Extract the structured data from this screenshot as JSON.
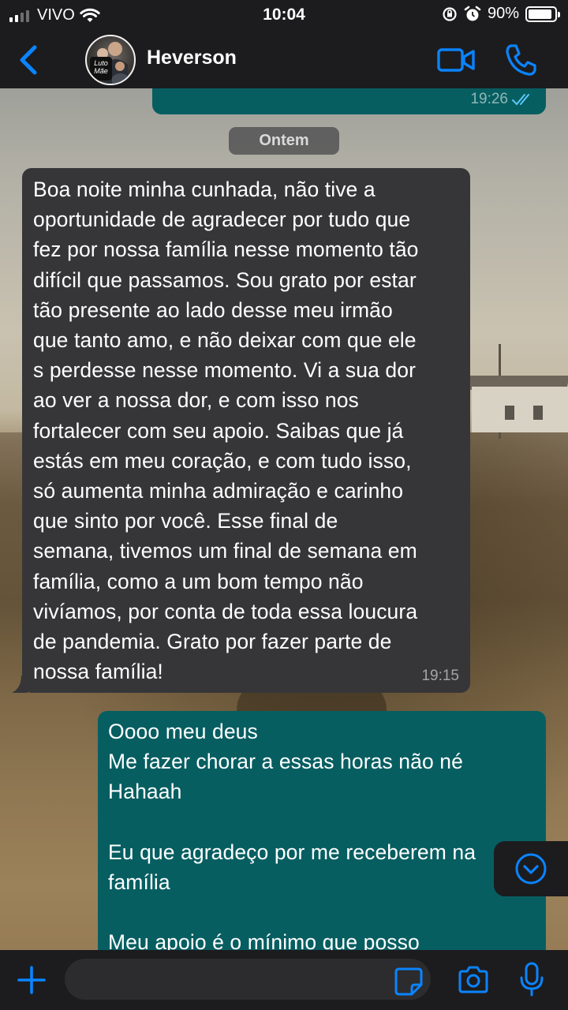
{
  "status_bar": {
    "carrier": "VIVO",
    "time": "10:04",
    "battery_percent": "90%",
    "battery_level": 0.9,
    "signal_bars_on": 2,
    "signal_bars_total": 4
  },
  "header": {
    "contact_name": "Heverson",
    "avatar_badge_line1": "Luto",
    "avatar_badge_line2": "Mãe"
  },
  "chat": {
    "top_outgoing_time": "19:26",
    "date_separator": "Ontem",
    "incoming": {
      "text": "Boa noite minha cunhada, não tive a\noportunidade de agradecer por tudo que\nfez por nossa família nesse momento tão\ndifícil que passamos. Sou grato por estar\ntão presente ao lado desse meu irmão\nque tanto amo, e não deixar com que ele\ns perdesse nesse momento. Vi a sua dor\nao ver a nossa dor, e com isso nos\nfortalecer com seu apoio. Saibas que já\nestás em meu coração, e com tudo isso,\nsó aumenta minha admiração e carinho\nque sinto por você. Esse final de\nsemana, tivemos um final de semana em\nfamília, como a um bom tempo não\nvivíamos, por conta de toda essa loucura\nde pandemia. Grato por fazer parte de\nnossa família!",
      "time": "19:15"
    },
    "outgoing": {
      "text": "Oooo meu deus\nMe fazer chorar a essas horas não né\nHahaah\n\nEu que agradeço por me receberem na\nfamília\n\nMeu apoio é o mínimo que posso"
    }
  },
  "input": {
    "placeholder": ""
  },
  "colors": {
    "accent": "#0a84ff",
    "outgoing_bubble": "#075e61",
    "incoming_bubble": "#363638",
    "bar_background": "#1c1c1e"
  },
  "icons": {
    "back": "chevron-left-icon",
    "video": "video-camera-icon",
    "call": "phone-icon",
    "scroll": "chevron-down-circle-icon",
    "plus": "plus-icon",
    "sticker": "sticker-icon",
    "camera": "camera-icon",
    "mic": "microphone-icon"
  }
}
